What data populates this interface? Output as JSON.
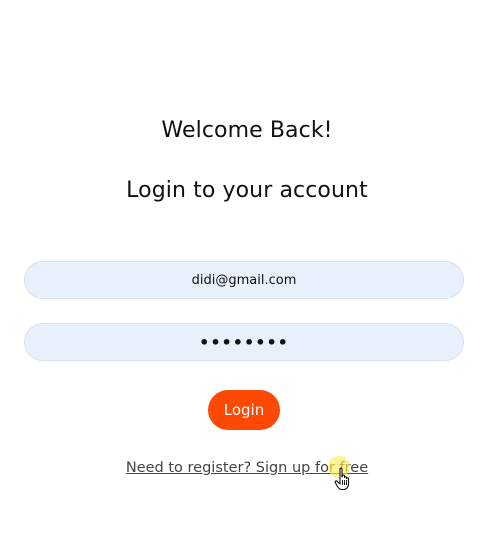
{
  "header": {
    "welcome": "Welcome Back!",
    "title": "Login to your account"
  },
  "form": {
    "email_value": "didi@gmail.com",
    "password_value": "••••••••",
    "login_label": "Login"
  },
  "footer": {
    "signup_text": "Need to register? Sign up for free"
  },
  "colors": {
    "accent": "#fe4904",
    "input_bg": "#e8f0fc"
  },
  "icons": {
    "cursor": "hand-pointer-icon"
  }
}
